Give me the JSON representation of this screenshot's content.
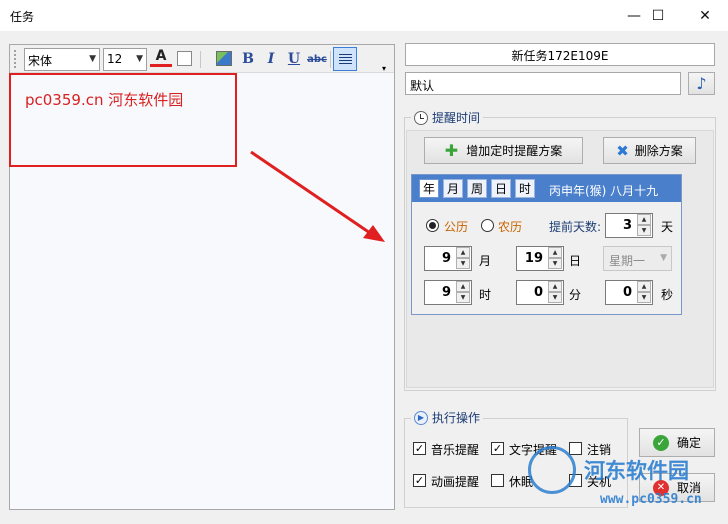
{
  "window": {
    "title": "任务",
    "minimize_glyph": "—",
    "maximize_glyph": "☐",
    "close_glyph": "✕"
  },
  "toolbar": {
    "font": "宋体",
    "size": "12",
    "font_color_glyph": "A",
    "bold_glyph": "B",
    "italic_glyph": "I",
    "underline_glyph": "U",
    "strike_glyph": "abc"
  },
  "editor": {
    "content": "pc0359.cn 河东软件园"
  },
  "task": {
    "name": "新任务172E109E",
    "category": "默认",
    "music_glyph": "♪"
  },
  "reminder": {
    "group_title": "提醒时间",
    "add_button": "增加定时提醒方案",
    "delete_button": "删除方案",
    "tabs": [
      "年",
      "月",
      "周",
      "日",
      "时"
    ],
    "lunar_date": "丙申年(猴) 八月十九",
    "solar_label": "公历",
    "lunar_label": "农历",
    "advance_label": "提前天数:",
    "advance_value": "3",
    "advance_unit": "天",
    "month_value": "9",
    "month_unit": "月",
    "day_value": "19",
    "day_unit": "日",
    "weekday": "星期一",
    "hour_value": "9",
    "hour_unit": "时",
    "minute_value": "0",
    "minute_unit": "分",
    "second_value": "0",
    "second_unit": "秒"
  },
  "actions": {
    "group_title": "执行操作",
    "music": "音乐提醒",
    "text": "文字提醒",
    "logout": "注销",
    "animation": "动画提醒",
    "sleep": "休眠",
    "shutdown": "关机",
    "ok_button": "确定",
    "cancel_button": "取消"
  },
  "watermark": {
    "name": "河东软件园",
    "url": "www.pc0359.cn"
  },
  "colors": {
    "annotation_red": "#e02020",
    "panel_header_blue": "#4a7fcb",
    "editor_text_red": "#d92020"
  }
}
